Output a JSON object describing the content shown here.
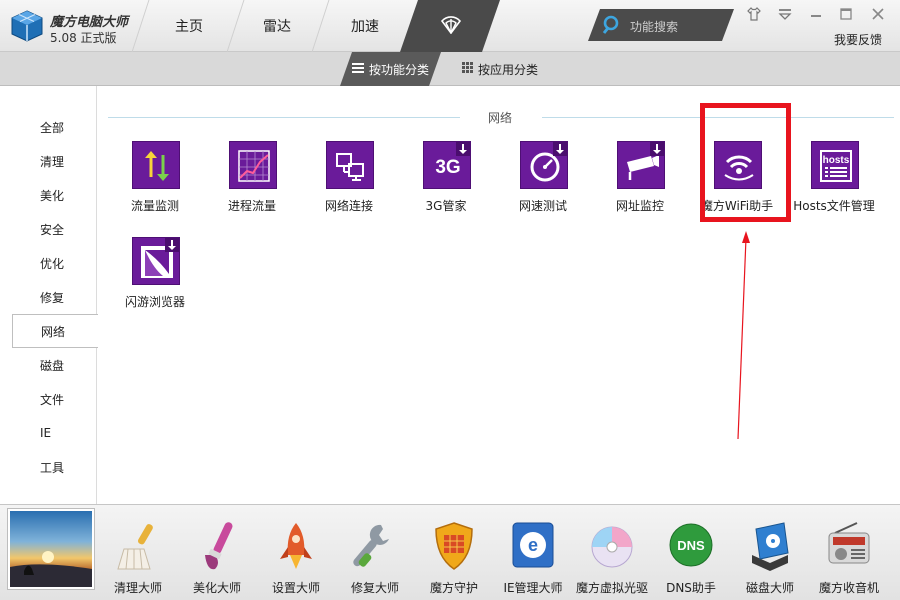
{
  "app": {
    "title": "魔方电脑大师",
    "version": "5.08 正式版"
  },
  "nav": {
    "tabs": [
      {
        "label": "主页",
        "icon": ""
      },
      {
        "label": "雷达",
        "icon": ""
      },
      {
        "label": "加速",
        "icon": ""
      },
      {
        "label": "",
        "icon": "radar-icon",
        "active": true
      }
    ]
  },
  "search": {
    "label": "功能搜索",
    "icon": "search-icon"
  },
  "window": {
    "feedback": "我要反馈",
    "buttons": [
      "shirt-icon",
      "dropdown-icon",
      "minimize-icon",
      "maximize-icon",
      "close-icon"
    ]
  },
  "subbar": {
    "tabs": [
      {
        "label": "按功能分类",
        "icon": "list-icon",
        "active": true
      },
      {
        "label": "按应用分类",
        "icon": "grid-icon",
        "active": false
      }
    ]
  },
  "categories": {
    "items": [
      "全部",
      "清理",
      "美化",
      "安全",
      "优化",
      "修复",
      "网络",
      "磁盘",
      "文件",
      "IE",
      "工具"
    ],
    "selected": "网络"
  },
  "section": {
    "title": "网络",
    "tools": [
      {
        "name": "流量监测",
        "icon": "traffic-arrows-icon",
        "download": false
      },
      {
        "name": "进程流量",
        "icon": "process-graph-icon",
        "download": false
      },
      {
        "name": "网络连接",
        "icon": "network-connection-icon",
        "download": false
      },
      {
        "name": "3G管家",
        "icon": "3g-icon",
        "download": true
      },
      {
        "name": "网速测试",
        "icon": "speedometer-icon",
        "download": true
      },
      {
        "name": "网址监控",
        "icon": "camera-icon",
        "download": true
      },
      {
        "name": "魔方WiFi助手",
        "icon": "wifi-icon",
        "download": false
      },
      {
        "name": "Hosts文件管理",
        "icon": "hosts-file-icon",
        "download": false
      },
      {
        "name": "闪游浏览器",
        "icon": "browser-icon",
        "download": true
      }
    ]
  },
  "colors": {
    "tile_purple": "#6a1b9a",
    "annotation_red": "#e8141e",
    "topbar_dark": "#4a4a4a"
  },
  "dock": {
    "items": [
      {
        "label": "清理大师",
        "icon": "broom-icon"
      },
      {
        "label": "美化大师",
        "icon": "paintbrush-icon"
      },
      {
        "label": "设置大师",
        "icon": "rocket-icon"
      },
      {
        "label": "修复大师",
        "icon": "wrench-icon"
      },
      {
        "label": "魔方守护",
        "icon": "shield-icon"
      },
      {
        "label": "IE管理大师",
        "icon": "ie-icon"
      },
      {
        "label": "魔方虚拟光驱",
        "icon": "disc-icon"
      },
      {
        "label": "DNS助手",
        "icon": "dns-icon"
      },
      {
        "label": "磁盘大师",
        "icon": "disk-icon"
      },
      {
        "label": "魔方收音机",
        "icon": "radio-icon"
      }
    ]
  }
}
